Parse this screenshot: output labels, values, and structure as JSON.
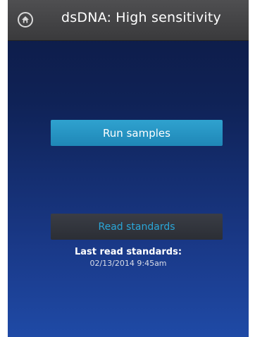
{
  "header": {
    "title": "dsDNA: High sensitivity",
    "home_icon": "home-icon"
  },
  "actions": {
    "run_samples_label": "Run samples",
    "read_standards_label": "Read standards"
  },
  "status": {
    "last_read_label": "Last read standards:",
    "last_read_value": "02/13/2014 9:45am"
  },
  "colors": {
    "run_button": "#2596c4",
    "read_button_text": "#2aa6d8",
    "header": "#444446",
    "background_top": "#0e1a44",
    "background_bottom": "#1f4aa6"
  }
}
